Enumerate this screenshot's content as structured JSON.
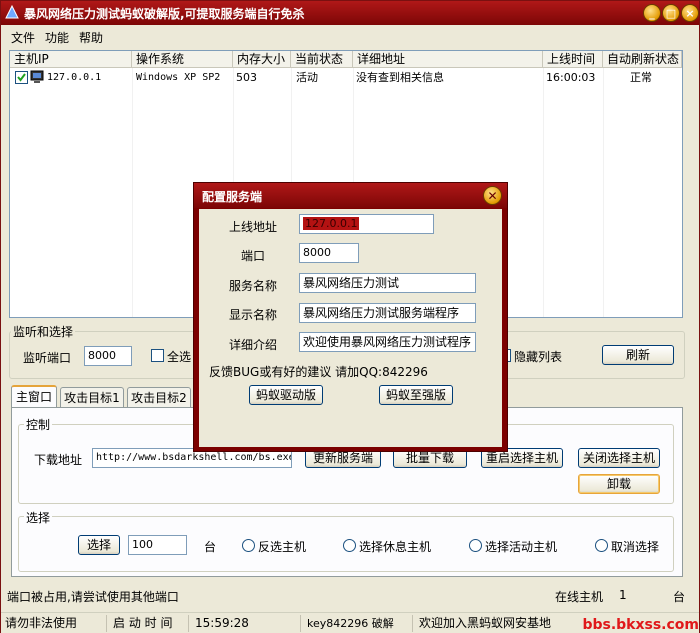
{
  "titlebar": {
    "title": "暴风网络压力测试蚂蚁破解版,可提取服务端自行免杀",
    "minimize": "_",
    "maximize": "□",
    "close": "×"
  },
  "menu": [
    "文件",
    "功能",
    "帮助"
  ],
  "list": {
    "columns": [
      "主机IP",
      "操作系统",
      "内存大小",
      "当前状态",
      "详细地址",
      "上线时间",
      "自动刷新状态"
    ],
    "rows": [
      {
        "ip": "127.0.0.1",
        "os": "Windows XP SP2",
        "memory": "503",
        "state": "活动",
        "address": "没有查到相关信息",
        "online_time": "16:00:03",
        "refresh_state": "正常"
      }
    ]
  },
  "listen": {
    "group_label": "监听和选择",
    "port_label": "监听端口",
    "port_value": "8000",
    "select_all": "全选",
    "hide_list": "隐藏列表",
    "refresh": "刷新"
  },
  "tabs": [
    "主窗口",
    "攻击目标1",
    "攻击目标2"
  ],
  "control": {
    "group_label": "控制",
    "download_label": "下载地址",
    "download_url": "http://www.bsdarkshell.com/bs.exe",
    "update_btn": "更新服务端",
    "batch_download_btn": "批量下载",
    "restart_btn": "重启选择主机",
    "shutdown_btn": "关闭选择主机",
    "uninstall_btn": "卸载"
  },
  "select": {
    "group_label": "选择",
    "select_btn": "选择",
    "count_value": "100",
    "unit": "台",
    "invert": "反选主机",
    "idle": "选择休息主机",
    "active": "选择活动主机",
    "cancel": "取消选择"
  },
  "status_line": {
    "message": "端口被占用,请尝试使用其他端口",
    "online_label": "在线主机",
    "online_count": "1",
    "unit": "台"
  },
  "statusbar": {
    "warning": "请勿非法使用",
    "start_label": "启 动 时 间",
    "start_time": "15:59:28",
    "crack": "key842296 破解",
    "welcome": "欢迎加入黑蚂蚁网安基地",
    "watermark": "bbs.bkxss.com"
  },
  "dialog": {
    "title": "配置服务端",
    "online_addr_label": "上线地址",
    "online_addr_value": "127.0.0.1",
    "port_label": "端口",
    "port_value": "8000",
    "service_name_label": "服务名称",
    "service_name_value": "暴风网络压力测试",
    "display_name_label": "显示名称",
    "display_name_value": "暴风网络压力测试服务端程序",
    "desc_label": "详细介绍",
    "desc_value": "欢迎使用暴风网络压力测试程序",
    "feedback": "反馈BUG或有好的建议 请加QQ:842296",
    "driver_btn": "蚂蚁驱动版",
    "ultimate_btn": "蚂蚁至强版"
  },
  "colors": {
    "title_red": "#9a0e0e",
    "accent_orange": "#e5a43a"
  }
}
